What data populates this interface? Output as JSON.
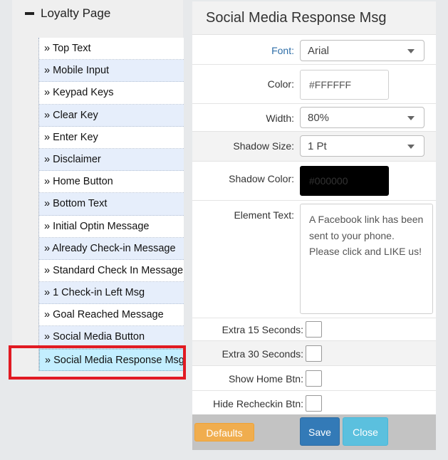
{
  "tree": {
    "header": "Loyalty Page",
    "items": [
      "» Top Text",
      "» Mobile Input",
      "» Keypad Keys",
      "» Clear Key",
      "» Enter Key",
      "» Disclaimer",
      "» Home Button",
      "» Bottom Text",
      "» Initial Optin Message",
      "» Already Check-in Message",
      "» Standard Check In Message",
      "» 1 Check-in Left Msg",
      "» Goal Reached Message",
      "» Social Media Button",
      "» Social Media Response Msg"
    ],
    "selected_index": 14
  },
  "panel": {
    "title": "Social Media Response Msg",
    "font_label": "Font:",
    "font_value": "Arial",
    "color_label": "Color:",
    "color_value": "#FFFFFF",
    "width_label": "Width:",
    "width_value": "80%",
    "shadow_size_label": "Shadow Size:",
    "shadow_size_value": "1 Pt",
    "shadow_color_label": "Shadow Color:",
    "shadow_color_value": "#000000",
    "element_text_label": "Element Text:",
    "element_text_value": "A Facebook link has been sent to your phone. Please click and LIKE us!",
    "extra15_label": "Extra 15 Seconds:",
    "extra30_label": "Extra 30 Seconds:",
    "show_home_label": "Show Home Btn:",
    "hide_recheckin_label": "Hide Recheckin Btn:"
  },
  "footer": {
    "defaults_label": "Defaults",
    "save_label": "Save",
    "close_label": "Close"
  },
  "colors": {
    "highlight": "#e11a22",
    "selected_item": "#c3eeff",
    "save": "#337ab7",
    "close": "#5bc0de",
    "defaults": "#f0ad4e"
  }
}
